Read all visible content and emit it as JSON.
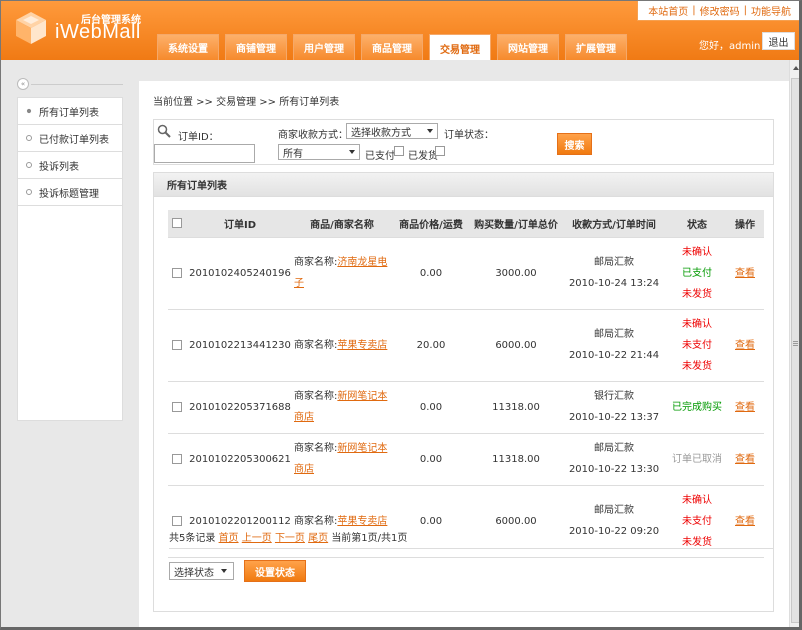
{
  "header": {
    "logo_sub": "后台管理系统",
    "logo_main": "iWebMall",
    "top_links": [
      "本站首页",
      "修改密码",
      "功能导航"
    ],
    "nav_tabs": [
      "系统设置",
      "商铺管理",
      "用户管理",
      "商品管理",
      "交易管理",
      "网站管理",
      "扩展管理"
    ],
    "active_tab": "交易管理",
    "welcome": "您好，admin",
    "logout": "退出",
    "brand_color": "#f58220"
  },
  "sidebar": {
    "items": [
      "所有订单列表",
      "已付款订单列表",
      "投诉列表",
      "投诉标题管理"
    ]
  },
  "breadcrumb": "当前位置 >> 交易管理 >> 所有订单列表",
  "search": {
    "order_id_label": "订单ID：",
    "order_id_value": "",
    "payment_label": "商家收款方式：",
    "payment_select": "选择收款方式",
    "status_label": "订单状态：",
    "status_select": "所有",
    "paid_label": "已支付",
    "shipped_label": "已发货",
    "search_button": "搜索"
  },
  "list": {
    "title": "所有订单列表",
    "columns": [
      "订单ID",
      "商品/商家名称",
      "商品价格/运费",
      "购买数量/订单总价",
      "收款方式/订单时间",
      "状态",
      "操作"
    ],
    "store_prefix": "商家名称:",
    "rows": [
      {
        "id": "2010102405240196",
        "store_l1": "济南龙星电",
        "store_l2": "子",
        "shipping": "0.00",
        "total": "3000.00",
        "pay_method": "邮局汇款",
        "time": "2010-10-24 13:24",
        "status": [
          {
            "text": "未确认",
            "color": "red"
          },
          {
            "text": "已支付",
            "color": "green"
          },
          {
            "text": "未发货",
            "color": "red"
          }
        ],
        "action": "查看"
      },
      {
        "id": "2010102213441230",
        "store_l1": "苹果专卖店",
        "store_l2": "",
        "shipping": "20.00",
        "total": "6000.00",
        "pay_method": "邮局汇款",
        "time": "2010-10-22 21:44",
        "status": [
          {
            "text": "未确认",
            "color": "red"
          },
          {
            "text": "未支付",
            "color": "red"
          },
          {
            "text": "未发货",
            "color": "red"
          }
        ],
        "action": "查看"
      },
      {
        "id": "2010102205371688",
        "store_l1": "新网笔记本",
        "store_l2": "商店",
        "shipping": "0.00",
        "total": "11318.00",
        "pay_method": "银行汇款",
        "time": "2010-10-22 13:37",
        "status": [
          {
            "text": "已完成购买",
            "color": "green"
          }
        ],
        "action": "查看"
      },
      {
        "id": "2010102205300621",
        "store_l1": "新网笔记本",
        "store_l2": "商店",
        "shipping": "0.00",
        "total": "11318.00",
        "pay_method": "邮局汇款",
        "time": "2010-10-22 13:30",
        "status": [
          {
            "text": "订单已取消",
            "color": "gray"
          }
        ],
        "action": "查看"
      },
      {
        "id": "2010102201200112",
        "store_l1": "苹果专卖店",
        "store_l2": "",
        "shipping": "0.00",
        "total": "6000.00",
        "pay_method": "邮局汇款",
        "time": "2010-10-22 09:20",
        "status": [
          {
            "text": "未确认",
            "color": "red"
          },
          {
            "text": "未支付",
            "color": "red"
          },
          {
            "text": "未发货",
            "color": "red"
          }
        ],
        "action": "查看"
      }
    ]
  },
  "pager": {
    "total_text": "共5条记录",
    "first": "首页",
    "prev": "上一页",
    "next": "下一页",
    "last": "尾页",
    "current_text": "当前第1页/共1页"
  },
  "footer": {
    "state_select": "选择状态",
    "set_button": "设置状态"
  }
}
